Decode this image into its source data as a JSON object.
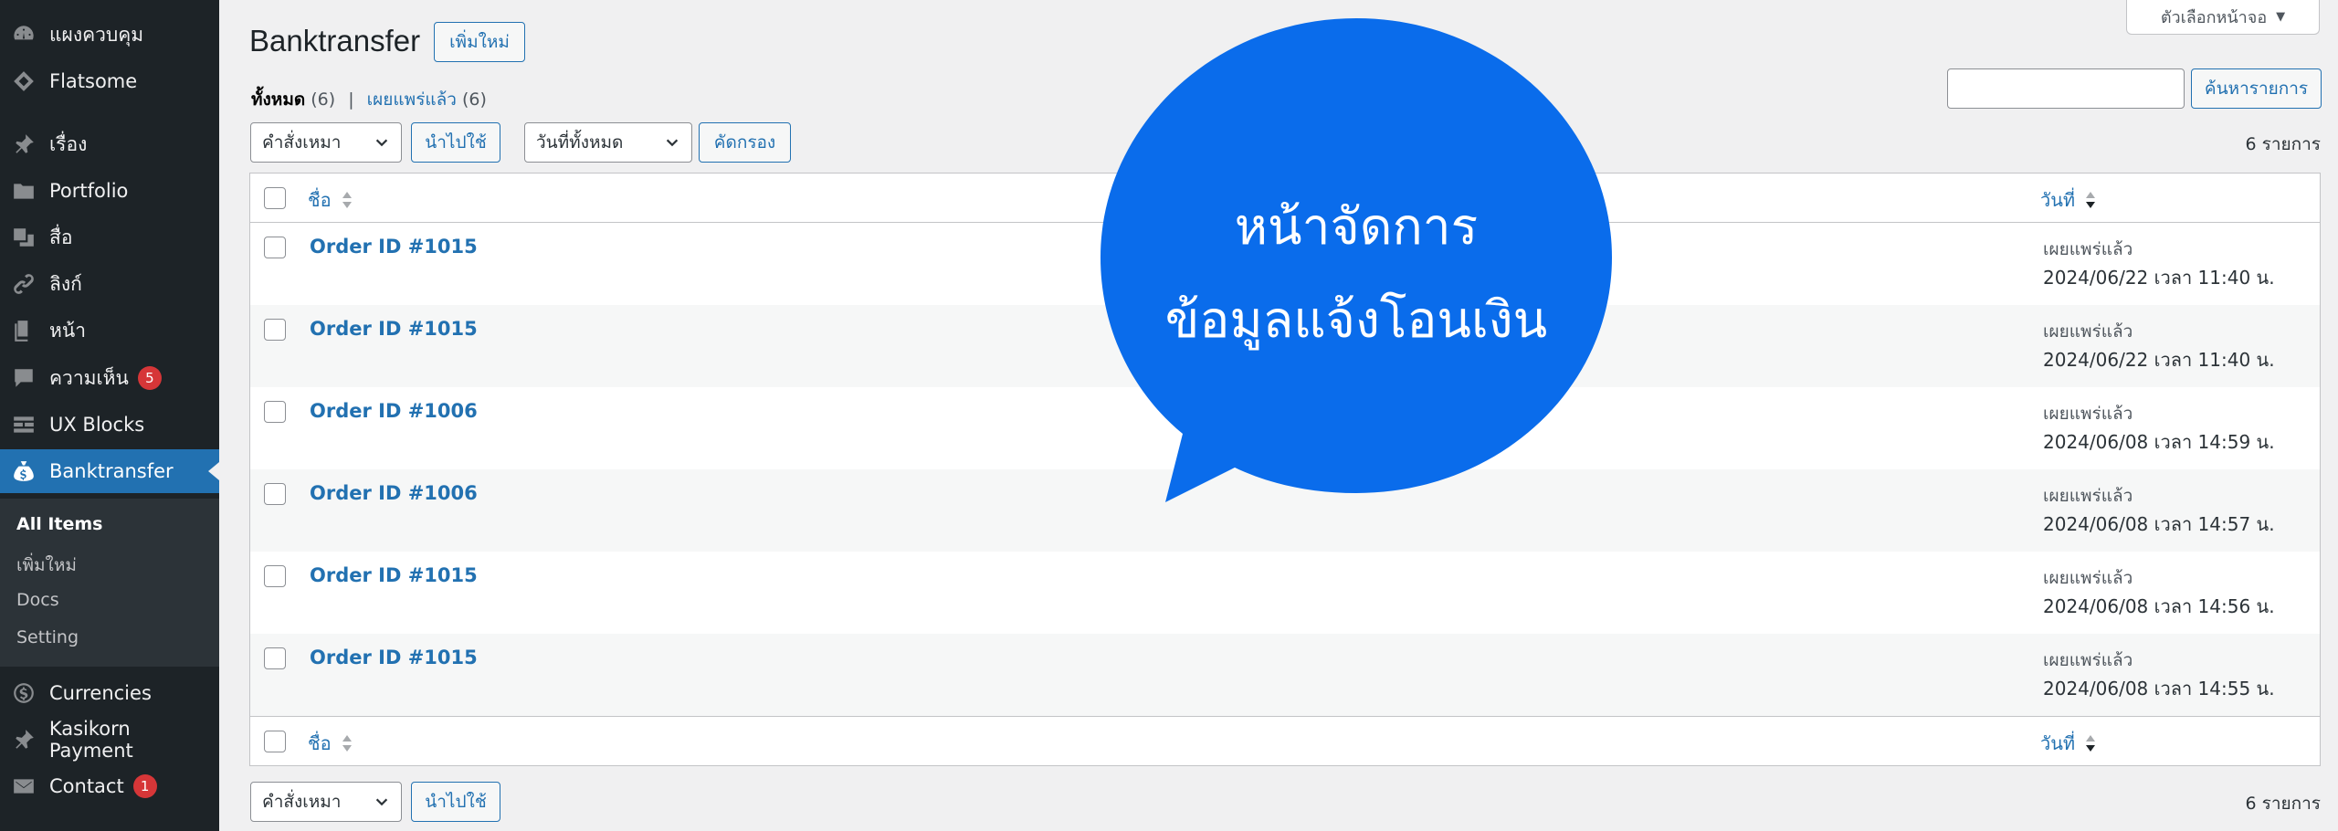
{
  "sidebar": {
    "items": [
      {
        "label": "แผงควบคุม",
        "icon": "dashboard-icon"
      },
      {
        "label": "Flatsome",
        "icon": "flatsome-icon"
      },
      {
        "label": "เรื่อง",
        "icon": "pin-icon"
      },
      {
        "label": "Portfolio",
        "icon": "folder-icon"
      },
      {
        "label": "สื่อ",
        "icon": "media-icon"
      },
      {
        "label": "ลิงก์",
        "icon": "link-icon"
      },
      {
        "label": "หน้า",
        "icon": "page-icon"
      },
      {
        "label": "ความเห็น",
        "icon": "comment-icon",
        "badge": "5"
      },
      {
        "label": "UX Blocks",
        "icon": "blocks-icon"
      },
      {
        "label": "Banktransfer",
        "icon": "money-bag-icon",
        "active": true
      },
      {
        "label": "Currencies",
        "icon": "dollar-icon"
      },
      {
        "label": "Kasikorn Payment",
        "icon": "pin-icon"
      },
      {
        "label": "Contact",
        "icon": "mail-icon",
        "badge": "1"
      }
    ],
    "submenu": [
      "All Items",
      "เพิ่มใหม่",
      "Docs",
      "Setting"
    ]
  },
  "header": {
    "title": "Banktransfer",
    "add_new": "เพิ่มใหม่",
    "screen_options": "ตัวเลือกหน้าจอ"
  },
  "views": {
    "all_label": "ทั้งหมด",
    "all_count": "(6)",
    "separator": "|",
    "published_label": "เผยแพร่แล้ว",
    "published_count": "(6)"
  },
  "filters": {
    "bulk_action": "คำสั่งเหมา",
    "apply": "นำไปใช้",
    "dates": "วันที่ทั้งหมด",
    "filter": "คัดกรอง",
    "search_button": "ค้นหารายการ",
    "search_value": "",
    "item_count": "6 รายการ"
  },
  "table": {
    "col_title": "ชื่อ",
    "col_date": "วันที่",
    "rows": [
      {
        "title": "Order ID #1015",
        "status": "เผยแพร่แล้ว",
        "date": "2024/06/22 เวลา 11:40 น."
      },
      {
        "title": "Order ID #1015",
        "status": "เผยแพร่แล้ว",
        "date": "2024/06/22 เวลา 11:40 น."
      },
      {
        "title": "Order ID #1006",
        "status": "เผยแพร่แล้ว",
        "date": "2024/06/08 เวลา 14:59 น."
      },
      {
        "title": "Order ID #1006",
        "status": "เผยแพร่แล้ว",
        "date": "2024/06/08 เวลา 14:57 น."
      },
      {
        "title": "Order ID #1015",
        "status": "เผยแพร่แล้ว",
        "date": "2024/06/08 เวลา 14:56 น."
      },
      {
        "title": "Order ID #1015",
        "status": "เผยแพร่แล้ว",
        "date": "2024/06/08 เวลา 14:55 น."
      }
    ]
  },
  "bubble": {
    "line1": "หน้าจัดการ",
    "line2": "ข้อมูลแจ้งโอนเงิน",
    "color": "#0a6ceb"
  },
  "colors": {
    "sidebar_bg": "#1d2327",
    "active_bg": "#2271b1",
    "link": "#2271b1",
    "badge": "#d63638"
  }
}
